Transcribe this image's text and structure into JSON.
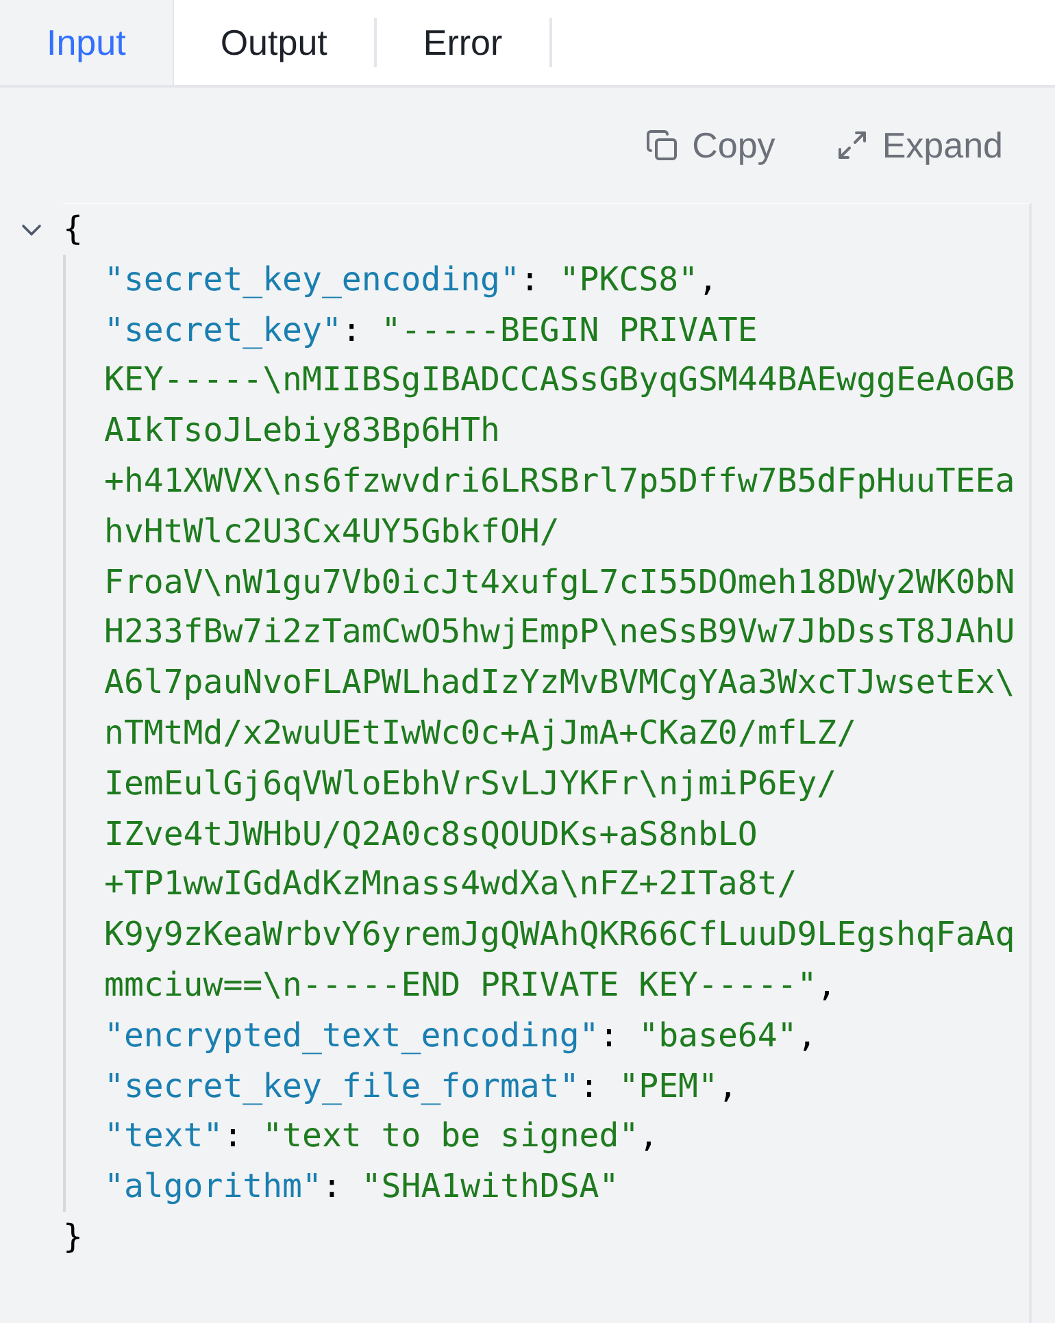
{
  "tabs": [
    {
      "label": "Input",
      "selected": true
    },
    {
      "label": "Output",
      "selected": false
    },
    {
      "label": "Error",
      "selected": false
    }
  ],
  "toolbar": [
    {
      "kind": "copy",
      "label": "Copy"
    },
    {
      "kind": "expand",
      "label": "Expand"
    }
  ],
  "code": {
    "expanded": true,
    "open": "{",
    "close": "}",
    "entries": [
      {
        "key": "\"secret_key_encoding\"",
        "colon": ":",
        "value_lines": [
          "\"PKCS8\""
        ],
        "comma": ","
      },
      {
        "key": "\"secret_key\"",
        "colon": ":",
        "value_lines": [
          "\"-----BEGIN PRIVATE",
          "KEY-----\\nMIIBSgIBADCCASsGByqGSM44BAEwggEeAoGB",
          "AIkTsoJLebiy83Bp6HTh",
          "+h41XWVX\\ns6fzwvdri6LRSBrl7p5Dffw7B5dFpHuuTEEa",
          "hvHtWlc2U3Cx4UY5GbkfOH/",
          "FroaV\\nW1gu7Vb0icJt4xufgL7cI55DOmeh18DWy2WK0bN",
          "H233fBw7i2zTamCwO5hwjEmpP\\neSsB9Vw7JbDssT8JAhU",
          "A6l7pauNvoFLAPWLhadIzYzMvBVMCgYAa3WxcTJwsetEx\\",
          "nTMtMd/x2wuUEtIwWc0c+AjJmA+CKaZ0/mfLZ/",
          "IemEulGj6qVWloEbhVrSvLJYKFr\\njmiP6Ey/",
          "IZve4tJWHbU/Q2A0c8sQOUDKs+aS8nbLO",
          "+TP1wwIGdAdKzMnass4wdXa\\nFZ+2ITa8t/",
          "K9y9zKeaWrbvY6yremJgQWAhQKR66CfLuuD9LEgshqFaAq",
          "mmciuw==\\n-----END PRIVATE KEY-----\""
        ],
        "comma": ","
      },
      {
        "key": "\"encrypted_text_encoding\"",
        "colon": ":",
        "value_lines": [
          "\"base64\""
        ],
        "comma": ","
      },
      {
        "key": "\"secret_key_file_format\"",
        "colon": ":",
        "value_lines": [
          "\"PEM\""
        ],
        "comma": ","
      },
      {
        "key": "\"text\"",
        "colon": ":",
        "value_lines": [
          "\"text to be signed\""
        ],
        "comma": ","
      },
      {
        "key": "\"algorithm\"",
        "colon": ":",
        "value_lines": [
          "\"SHA1withDSA\""
        ]
      }
    ]
  }
}
